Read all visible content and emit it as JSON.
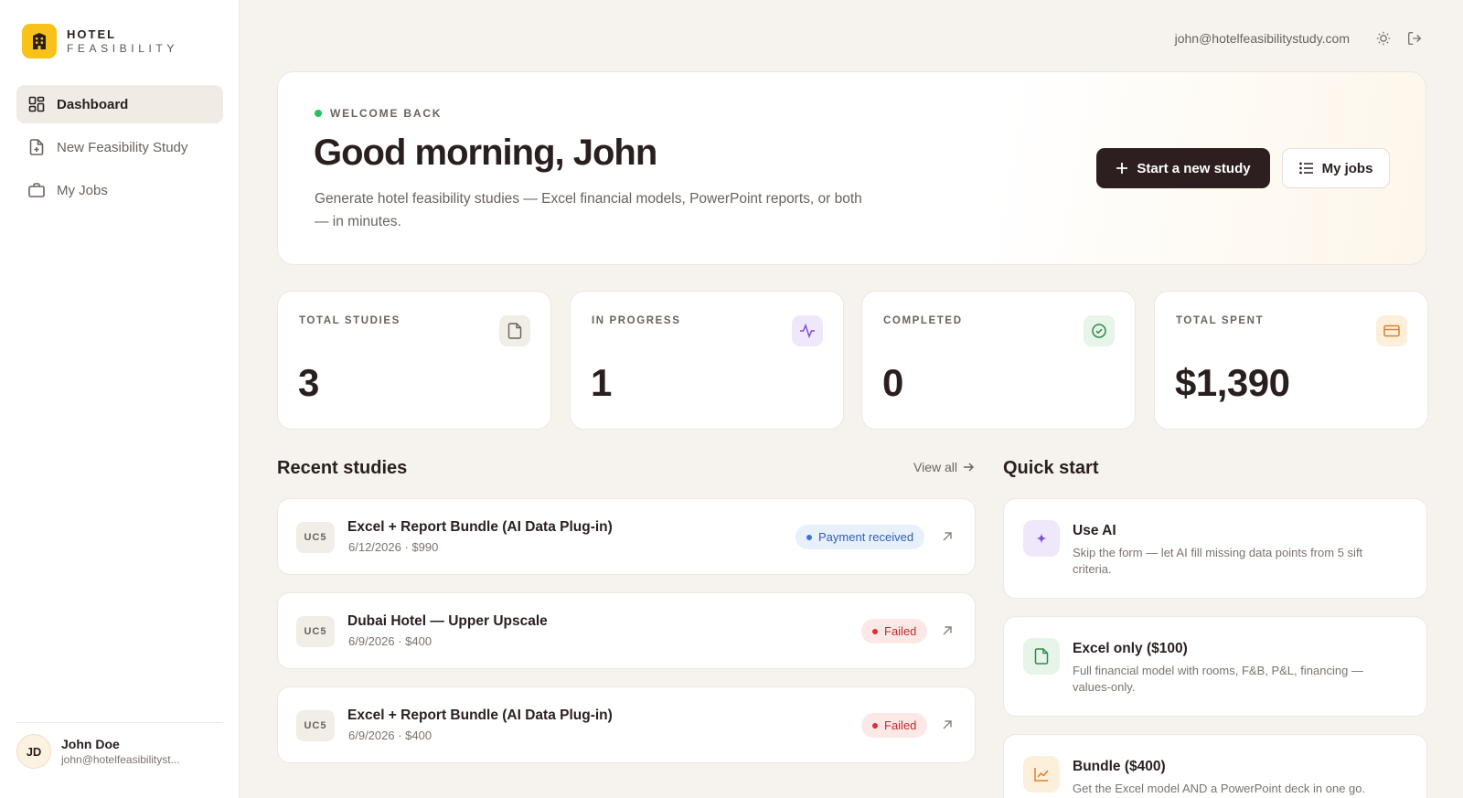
{
  "brand": {
    "line1": "HOTEL",
    "line2": "FEASIBILITY"
  },
  "sidebar": {
    "items": [
      {
        "label": "Dashboard",
        "icon": "dashboard-icon",
        "active": true
      },
      {
        "label": "New Feasibility Study",
        "icon": "file-plus-icon"
      },
      {
        "label": "My Jobs",
        "icon": "briefcase-icon"
      }
    ],
    "user": {
      "initials": "JD",
      "name": "John Doe",
      "email": "john@hotelfeasibilityst..."
    }
  },
  "topbar": {
    "email": "john@hotelfeasibilitystudy.com"
  },
  "hero": {
    "eyebrow": "WELCOME BACK",
    "greeting": "Good morning, John",
    "subtitle": "Generate hotel feasibility studies — Excel financial models, PowerPoint reports, or both — in minutes.",
    "primary_button": "Start a new study",
    "secondary_button": "My jobs"
  },
  "stats": [
    {
      "label": "TOTAL STUDIES",
      "value": "3",
      "icon": "file-icon",
      "color": "#f1ede7"
    },
    {
      "label": "IN PROGRESS",
      "value": "1",
      "icon": "activity-icon",
      "color": "#efe8fb"
    },
    {
      "label": "COMPLETED",
      "value": "0",
      "icon": "check-circle-icon",
      "color": "#e6f4ea"
    },
    {
      "label": "TOTAL SPENT",
      "value": "$1,390",
      "icon": "credit-card-icon",
      "color": "#fcefdc"
    }
  ],
  "recent": {
    "title": "Recent studies",
    "view_all": "View all",
    "items": [
      {
        "code": "UC5",
        "title": "Excel + Report Bundle (AI Data Plug-in)",
        "meta": "6/12/2026 · $990",
        "status": "Payment received",
        "status_type": "info"
      },
      {
        "code": "UC5",
        "title": "Dubai Hotel — Upper Upscale",
        "meta": "6/9/2026 · $400",
        "status": "Failed",
        "status_type": "fail"
      },
      {
        "code": "UC5",
        "title": "Excel + Report Bundle (AI Data Plug-in)",
        "meta": "6/9/2026 · $400",
        "status": "Failed",
        "status_type": "fail"
      }
    ]
  },
  "quick_start": {
    "title": "Quick start",
    "items": [
      {
        "title": "Use AI",
        "desc": "Skip the form — let AI fill missing data points from 5 sift criteria.",
        "icon": "sparkle-icon",
        "color": "#efe8fb"
      },
      {
        "title": "Excel only ($100)",
        "desc": "Full financial model with rooms, F&B, P&L, financing — values-only.",
        "icon": "file-icon",
        "color": "#e6f4ea"
      },
      {
        "title": "Bundle ($400)",
        "desc": "Get the Excel model AND a PowerPoint deck in one go.",
        "icon": "chart-line-icon",
        "color": "#fcefdc"
      }
    ]
  }
}
